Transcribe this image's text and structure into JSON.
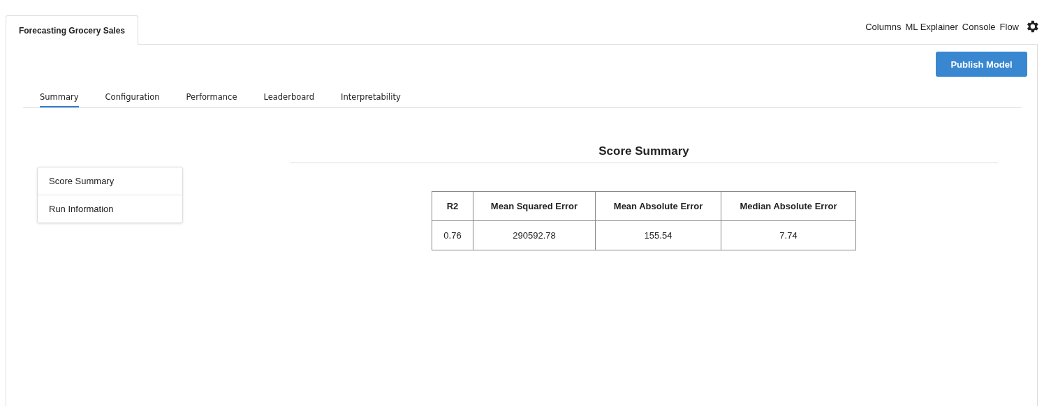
{
  "project_tab": {
    "label": "Forecasting Grocery Sales",
    "selected": true
  },
  "top_links": [
    "Columns",
    "ML Explainer",
    "Console",
    "Flow"
  ],
  "publish_button": "Publish Model",
  "tabs": [
    {
      "label": "Summary",
      "selected": true
    },
    {
      "label": "Configuration",
      "selected": false
    },
    {
      "label": "Performance",
      "selected": false
    },
    {
      "label": "Leaderboard",
      "selected": false
    },
    {
      "label": "Interpretability",
      "selected": false
    }
  ],
  "side_menu": [
    {
      "label": "Score Summary"
    },
    {
      "label": "Run Information"
    }
  ],
  "section_title": "Score Summary",
  "table": {
    "columns": [
      "R2",
      "Mean Squared Error",
      "Mean Absolute Error",
      "Median Absolute Error"
    ],
    "rows": [
      [
        "0.76",
        "290592.78",
        "155.54",
        "7.74"
      ]
    ]
  }
}
